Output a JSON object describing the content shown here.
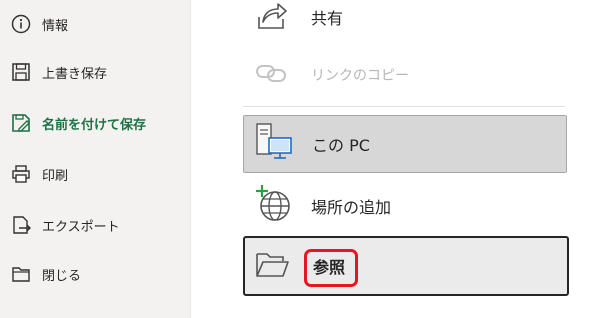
{
  "sidebar": {
    "items": [
      {
        "label": "情報",
        "icon": "info-icon"
      },
      {
        "label": "上書き保存",
        "icon": "save-icon"
      },
      {
        "label": "名前を付けて保存",
        "icon": "save-as-icon",
        "active": true
      },
      {
        "label": "印刷",
        "icon": "printer-icon"
      },
      {
        "label": "エクスポート",
        "icon": "export-icon"
      },
      {
        "label": "閉じる",
        "icon": "folder-close-icon"
      }
    ]
  },
  "main": {
    "options": [
      {
        "label": "共有",
        "icon": "share-icon"
      },
      {
        "label": "リンクのコピー",
        "icon": "link-icon",
        "disabled": true
      },
      {
        "label": "この PC",
        "icon": "this-pc-icon",
        "selected": true
      },
      {
        "label": "場所の追加",
        "icon": "add-place-icon"
      },
      {
        "label": "参照",
        "icon": "browse-folder-icon"
      }
    ]
  },
  "colors": {
    "accent": "#1e7145",
    "highlight": "#e8141f",
    "sidebar_bg": "#f3f2f1"
  }
}
